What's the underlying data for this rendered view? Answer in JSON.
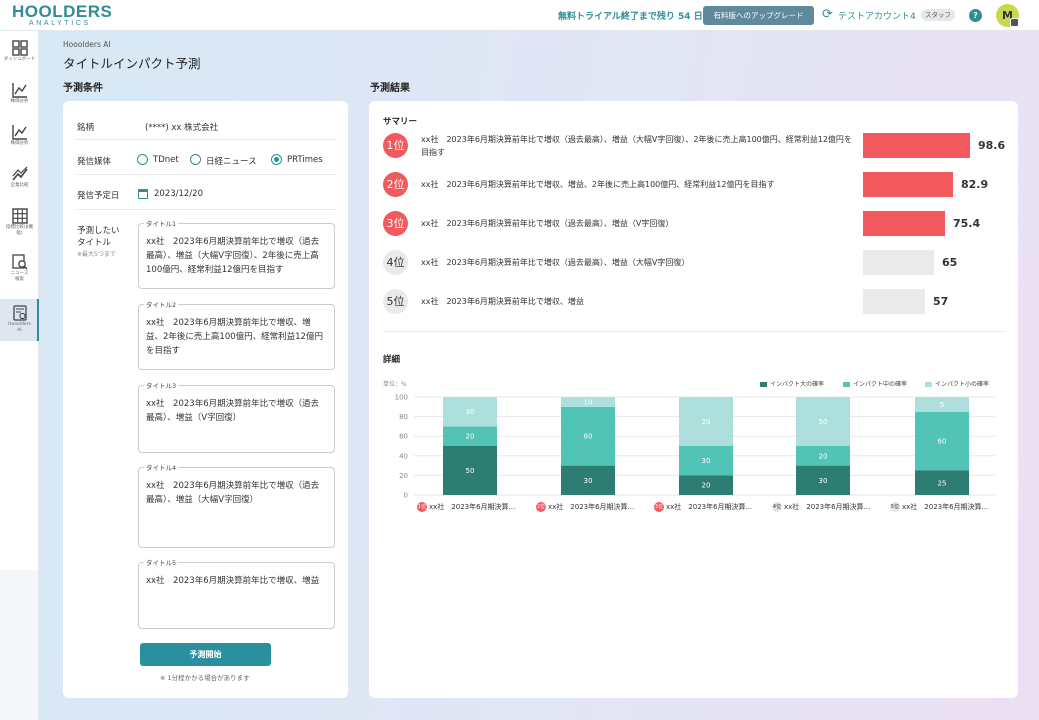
{
  "header": {
    "logo_main": "HOOLDERS",
    "logo_sub": "ANALYTICS",
    "trial_text": "無料トライアル終了まで残り 54 日",
    "upgrade_label": "有料版へのアップグレード",
    "account_name": "テストアカウント4",
    "role_badge": "スタッフ",
    "help": "?",
    "avatar_initial": "M",
    "account_icon": "refresh-icon",
    "colors": {
      "brand": "#2f8d96",
      "upgrade_bg": "#5f8a9c"
    }
  },
  "sidebar": {
    "items": [
      {
        "label": "ダッシュボード",
        "icon": "dashboard-icon"
      },
      {
        "label": "株価分析",
        "icon": "line-chart-icon"
      },
      {
        "label": "株価分析",
        "icon": "line-chart-icon"
      },
      {
        "label": "企業比較",
        "icon": "trend-icon"
      },
      {
        "label": "指標比較(β機能)",
        "icon": "table-icon"
      },
      {
        "label": "ニュース検索",
        "icon": "news-search-icon"
      },
      {
        "label": "Hooolders AI",
        "icon": "ai-icon",
        "active": true
      }
    ]
  },
  "breadcrumb": "Hooolders AI",
  "page_title": "タイトルインパクト予測",
  "conditions": {
    "section_title": "予測条件",
    "stock_label": "銘柄",
    "stock_value": "(****) xx 株式会社",
    "media_label": "発信媒体",
    "media_options": [
      "TDnet",
      "日経ニュース",
      "PRTimes"
    ],
    "media_selected": "PRTimes",
    "date_label": "発信予定日",
    "date_value": "2023/12/20",
    "titles_label_1": "予測したい",
    "titles_label_2": "タイトル",
    "titles_note": "※最大5つまで",
    "titles": [
      {
        "label": "タイトル1",
        "value": "xx社　2023年6月期決算前年比で増収（過去最高）、増益（大幅V字回復）、2年後に売上高100億円、経常利益12億円を目指す"
      },
      {
        "label": "タイトル2",
        "value": "xx社　2023年6月期決算前年比で増収、増益、2年後に売上高100億円、経常利益12億円を目指す"
      },
      {
        "label": "タイトル3",
        "value": "xx社　2023年6月期決算前年比で増収（過去最高）、増益（V字回復）"
      },
      {
        "label": "タイトル4",
        "value": "xx社　2023年6月期決算前年比で増収（過去最高）、増益（大幅V字回復）"
      },
      {
        "label": "タイトル5",
        "value": "xx社　2023年6月期決算前年比で増収、増益"
      }
    ],
    "start_button": "予測開始",
    "start_note": "※ 1分程かかる場合があります"
  },
  "results": {
    "section_title": "予測結果",
    "summary_title": "サマリー",
    "summary": [
      {
        "rank": "1位",
        "text": "xx社　2023年6月期決算前年比で増収（過去最高）、増益（大幅V字回復）、2年後に売上高100億円、経常利益12億円を目指す",
        "score": 98.6,
        "score_label": "98.6",
        "hot": true
      },
      {
        "rank": "2位",
        "text": "xx社　2023年6月期決算前年比で増収、増益、2年後に売上高100億円、経常利益12億円を目指す",
        "score": 82.9,
        "score_label": "82.9",
        "hot": true
      },
      {
        "rank": "3位",
        "text": "xx社　2023年6月期決算前年比で増収（過去最高）、増益（V字回復）",
        "score": 75.4,
        "score_label": "75.4",
        "hot": true
      },
      {
        "rank": "4位",
        "text": "xx社　2023年6月期決算前年比で増収（過去最高）、増益（大幅V字回復）",
        "score": 65,
        "score_label": "65",
        "hot": false
      },
      {
        "rank": "5位",
        "text": "xx社　2023年6月期決算前年比で増収、増益",
        "score": 57,
        "score_label": "57",
        "hot": false
      }
    ],
    "detail_title": "詳細",
    "colors": {
      "hot": "#f1595e",
      "cold": "#eaeaea"
    }
  },
  "chart_data": {
    "type": "bar",
    "stacked": true,
    "ylabel": "単位：%",
    "ylim": [
      0,
      100
    ],
    "yticks": [
      0,
      20,
      40,
      60,
      80,
      100
    ],
    "grid": true,
    "legend_position": "top-right",
    "categories": [
      "xx社　2023年6月期決算...",
      "xx社　2023年6月期決算...",
      "xx社　2023年6月期決算...",
      "xx社　2023年6月期決算...",
      "xx社　2023年6月期決算..."
    ],
    "category_ranks": [
      "1位",
      "2位",
      "3位",
      "4位",
      "5位"
    ],
    "category_hot": [
      true,
      true,
      true,
      false,
      false
    ],
    "series": [
      {
        "name": "インパクト大の確率",
        "color": "#2e7d72",
        "values": [
          50,
          30,
          20,
          30,
          25
        ]
      },
      {
        "name": "インパクト中の確率",
        "color": "#52c4b6",
        "values": [
          20,
          60,
          30,
          20,
          60
        ]
      },
      {
        "name": "インパクト小の確率",
        "color": "#ade0dd",
        "values": [
          30,
          10,
          50,
          50,
          15
        ]
      }
    ],
    "data_labels": [
      [
        "50",
        "30",
        "20",
        "30",
        "25"
      ],
      [
        "20",
        "60",
        "30",
        "20",
        "60"
      ],
      [
        "30",
        "10",
        "20",
        "50",
        "5"
      ]
    ]
  }
}
